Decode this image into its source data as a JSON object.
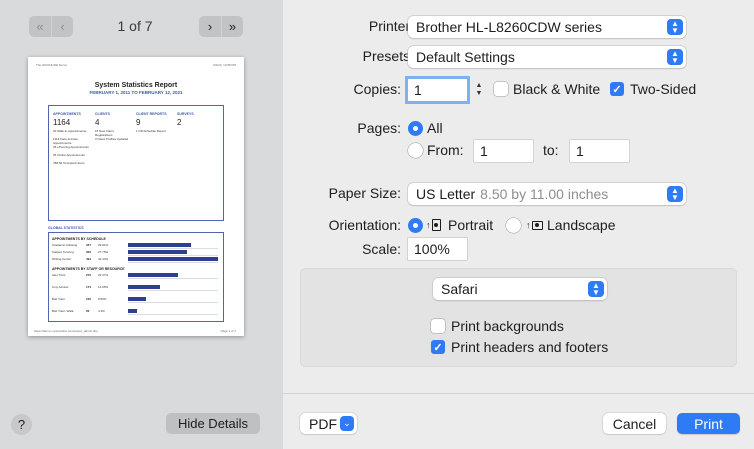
{
  "preview": {
    "page_count_label": "1 of 7",
    "nav_first_icon": "double-chevron-left",
    "nav_prev_icon": "chevron-left",
    "nav_next_icon": "chevron-right",
    "nav_last_icon": "double-chevron-right",
    "help_label": "?",
    "hide_details_label": "Hide Details",
    "doc": {
      "header_left": "The WCONLINE Demo",
      "header_right": "3/2/23, 12:58 PM",
      "title": "System Statistics Report",
      "subtitle": "FEBRUARY 1, 2011 TO FEBRUARY 12, 2021",
      "stats": [
        {
          "heading": "APPOINTMENTS",
          "value": "1164",
          "details": [
            "20 Walk-In Appointments",
            "1114 Face-to-Face Appointments",
            "25 eTutoring Appointments",
            "25 Online Appointments",
            "788.50 Occupied Hours"
          ]
        },
        {
          "heading": "CLIENTS",
          "value": "4",
          "details": [
            "15 New Client Registrations",
            "0 Client Profiles Updated"
          ]
        },
        {
          "heading": "CLIENT REPORTS",
          "value": "9",
          "details": [
            "1 Off-Schedule Report"
          ]
        },
        {
          "heading": "SURVEYS",
          "value": "2",
          "details": []
        }
      ],
      "global_heading": "GLOBAL STATISTICS",
      "schedule_heading": "APPOINTMENTS BY SCHEDULE",
      "schedule_rows": [
        {
          "label": "Academic Advising",
          "count": "347",
          "pct": "29.81%",
          "fraction": 0.2981
        },
        {
          "label": "Subject Tutoring",
          "count": "323",
          "pct": "27.75%",
          "fraction": 0.2775
        },
        {
          "label": "Writing Center",
          "count": "494",
          "pct": "42.44%",
          "fraction": 0.4244
        }
      ],
      "staff_heading": "APPOINTMENTS BY STAFF OR RESOURCE",
      "staff_rows": [
        {
          "label": "Alex Tutor",
          "count": "272",
          "pct": "23.37%",
          "fraction": 0.2337
        },
        {
          "label": "Amy Advisor",
          "count": "174",
          "pct": "14.95%",
          "fraction": 0.1495
        },
        {
          "label": "Bob Tutor",
          "count": "100",
          "pct": "8.59%",
          "fraction": 0.0859
        },
        {
          "label": "Bob Tutor: Walk-",
          "count": "50",
          "pct": "4.3%",
          "fraction": 0.043
        }
      ],
      "footer_left": "https://demo.mywconline.com/report_admin.php",
      "footer_right": "Page 1 of 7"
    }
  },
  "settings": {
    "printer_label": "Printer:",
    "printer_value": "Brother HL-L8260CDW series",
    "presets_label": "Presets:",
    "presets_value": "Default Settings",
    "copies_label": "Copies:",
    "copies_value": "1",
    "black_white_label": "Black & White",
    "black_white_checked": false,
    "two_sided_label": "Two-Sided",
    "two_sided_checked": true,
    "pages_label": "Pages:",
    "pages_all_label": "All",
    "pages_from_label": "From:",
    "pages_from_value": "1",
    "pages_to_label": "to:",
    "pages_to_value": "1",
    "paper_size_label": "Paper Size:",
    "paper_size_value": "US Letter",
    "paper_size_dims": "8.50 by 11.00 inches",
    "orientation_label": "Orientation:",
    "portrait_label": "Portrait",
    "landscape_label": "Landscape",
    "scale_label": "Scale:",
    "scale_value": "100%",
    "app_section_value": "Safari",
    "print_backgrounds_label": "Print backgrounds",
    "print_backgrounds_checked": false,
    "print_headers_label": "Print headers and footers",
    "print_headers_checked": true
  },
  "footer": {
    "pdf_label": "PDF",
    "cancel_label": "Cancel",
    "print_label": "Print"
  },
  "colors": {
    "accent": "#2f7bf5",
    "report_blue": "#3e57a6",
    "bar": "#2f3f8f"
  }
}
